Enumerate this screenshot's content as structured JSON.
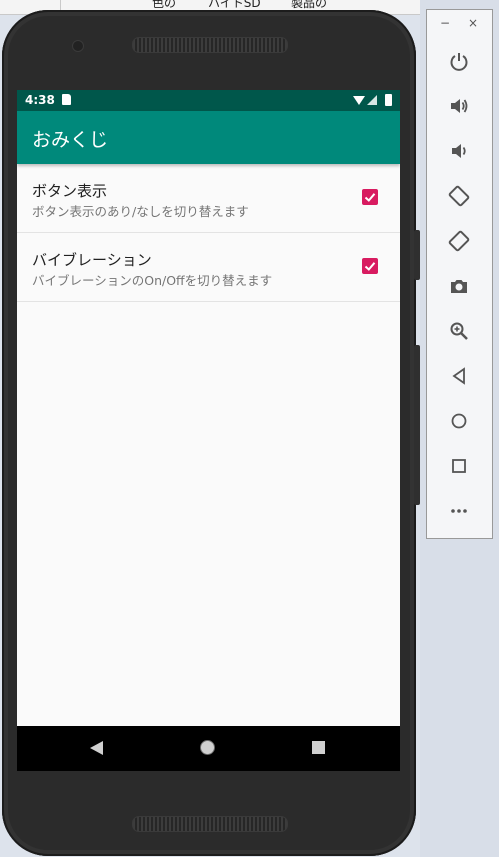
{
  "background": {
    "menu_items": [
      "色の",
      "ハイトSD",
      "製品の"
    ]
  },
  "status_bar": {
    "time": "4:38"
  },
  "app_bar": {
    "title": "おみくじ"
  },
  "preferences": [
    {
      "title": "ボタン表示",
      "summary": "ボタン表示のあり/なしを切り替えます",
      "checked": true
    },
    {
      "title": "バイブレーション",
      "summary": "バイブレーションのOn/Offを切り替えます",
      "checked": true
    }
  ],
  "toolbar": {
    "minimize_label": "−",
    "close_label": "×",
    "buttons": [
      "power-icon",
      "volume-up-icon",
      "volume-down-icon",
      "rotate-left-icon",
      "rotate-right-icon",
      "camera-icon",
      "zoom-icon",
      "back-icon",
      "home-icon",
      "overview-icon",
      "more-icon"
    ]
  },
  "colors": {
    "status_bar": "#00574b",
    "app_bar": "#00897b",
    "accent": "#d81b60"
  }
}
